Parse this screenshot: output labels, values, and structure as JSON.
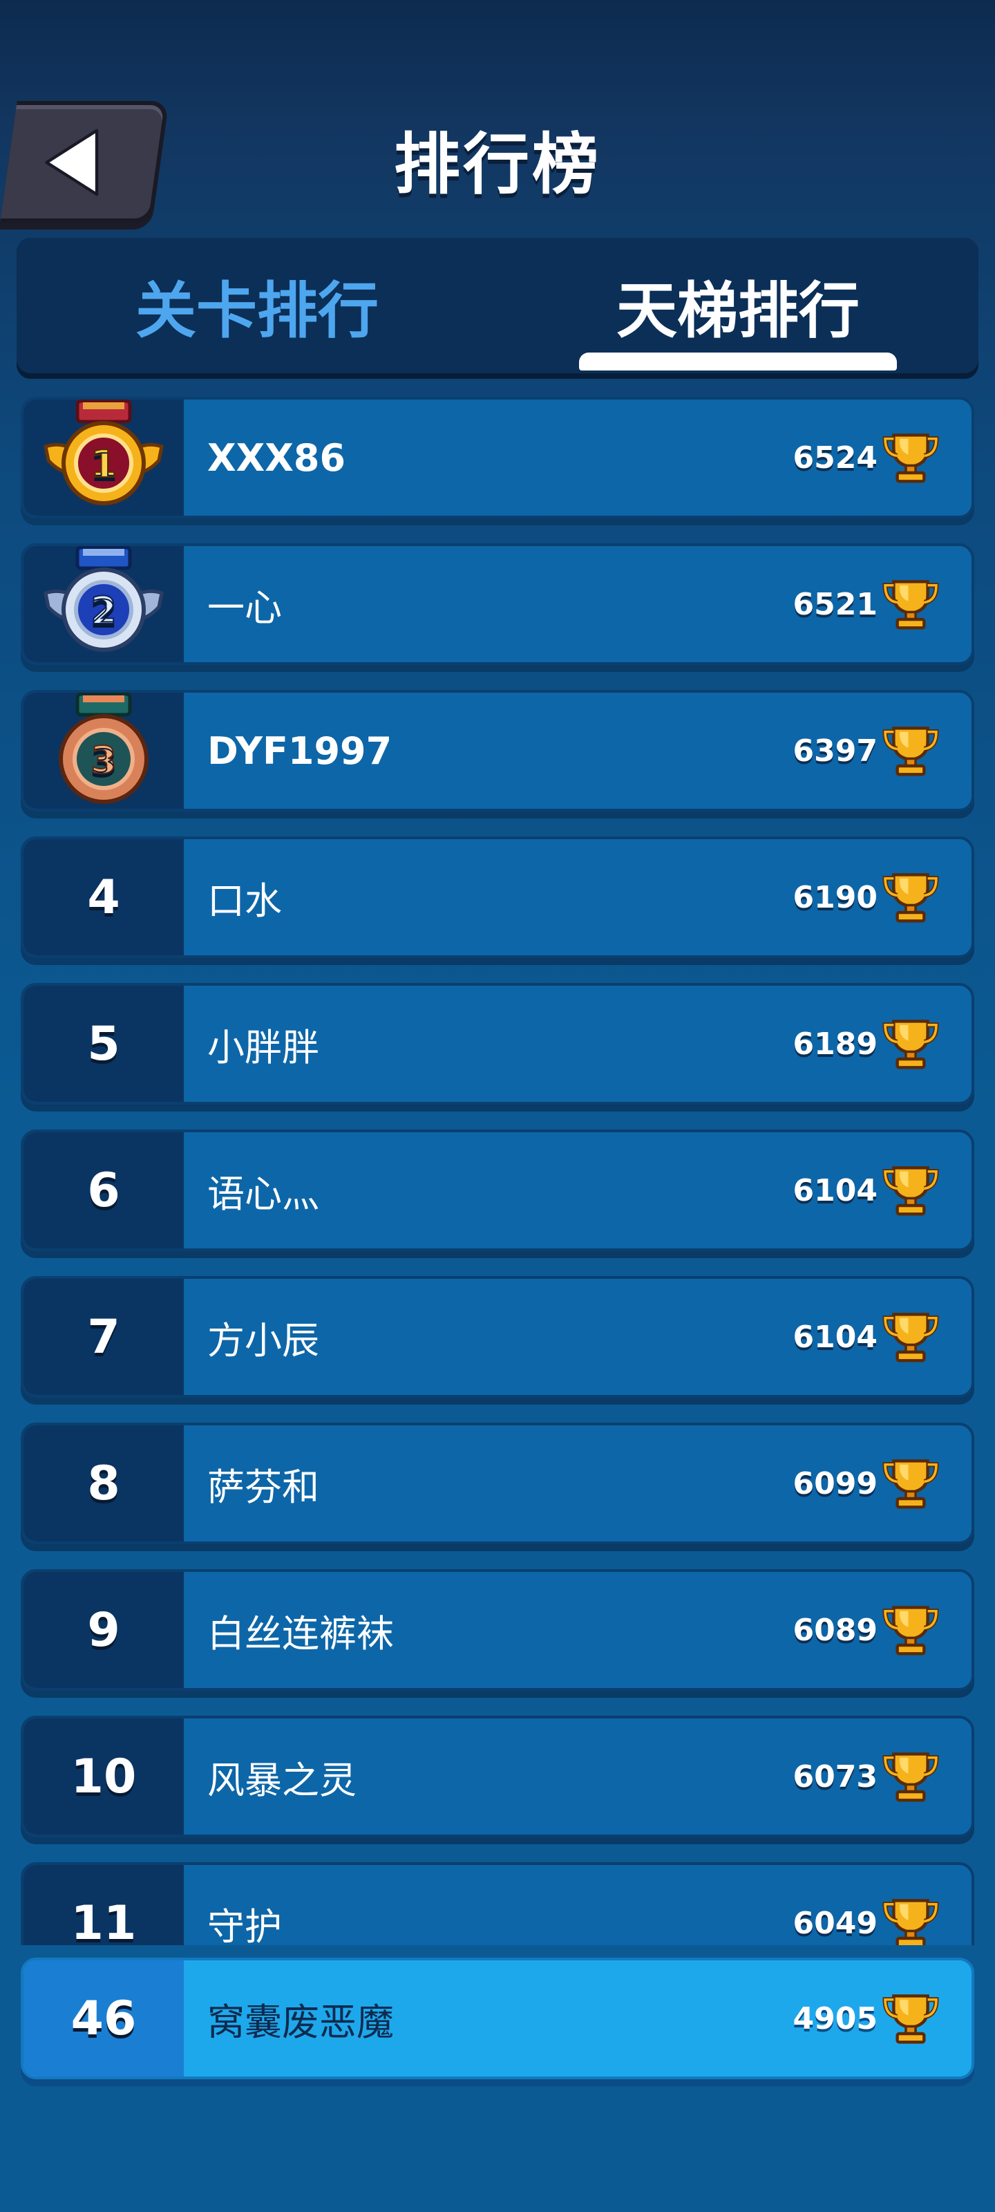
{
  "header": {
    "title": "排行榜",
    "back_icon": "back-arrow-icon"
  },
  "tabs": [
    {
      "label": "关卡排行",
      "active": false
    },
    {
      "label": "天梯排行",
      "active": true
    }
  ],
  "leaderboard": [
    {
      "rank": "1",
      "name": "XXX86",
      "score": "6524",
      "medal": "gold"
    },
    {
      "rank": "2",
      "name": "一心",
      "score": "6521",
      "medal": "silver"
    },
    {
      "rank": "3",
      "name": "DYF1997",
      "score": "6397",
      "medal": "bronze"
    },
    {
      "rank": "4",
      "name": "口水",
      "score": "6190"
    },
    {
      "rank": "5",
      "name": "小胖胖",
      "score": "6189"
    },
    {
      "rank": "6",
      "name": "语心灬",
      "score": "6104"
    },
    {
      "rank": "7",
      "name": "方小辰",
      "score": "6104"
    },
    {
      "rank": "8",
      "name": "萨芬和",
      "score": "6099"
    },
    {
      "rank": "9",
      "name": "白丝连裤袜",
      "score": "6089"
    },
    {
      "rank": "10",
      "name": "风暴之灵",
      "score": "6073"
    },
    {
      "rank": "11",
      "name": "守护",
      "score": "6049"
    }
  ],
  "self": {
    "rank": "46",
    "name": "窝囊废恶魔",
    "score": "4905"
  },
  "colors": {
    "gold": "#f6b21b",
    "silver": "#9fb6d8",
    "bronze": "#d9825a",
    "row": "#0d66a8",
    "self_row": "#1ea8ec"
  }
}
